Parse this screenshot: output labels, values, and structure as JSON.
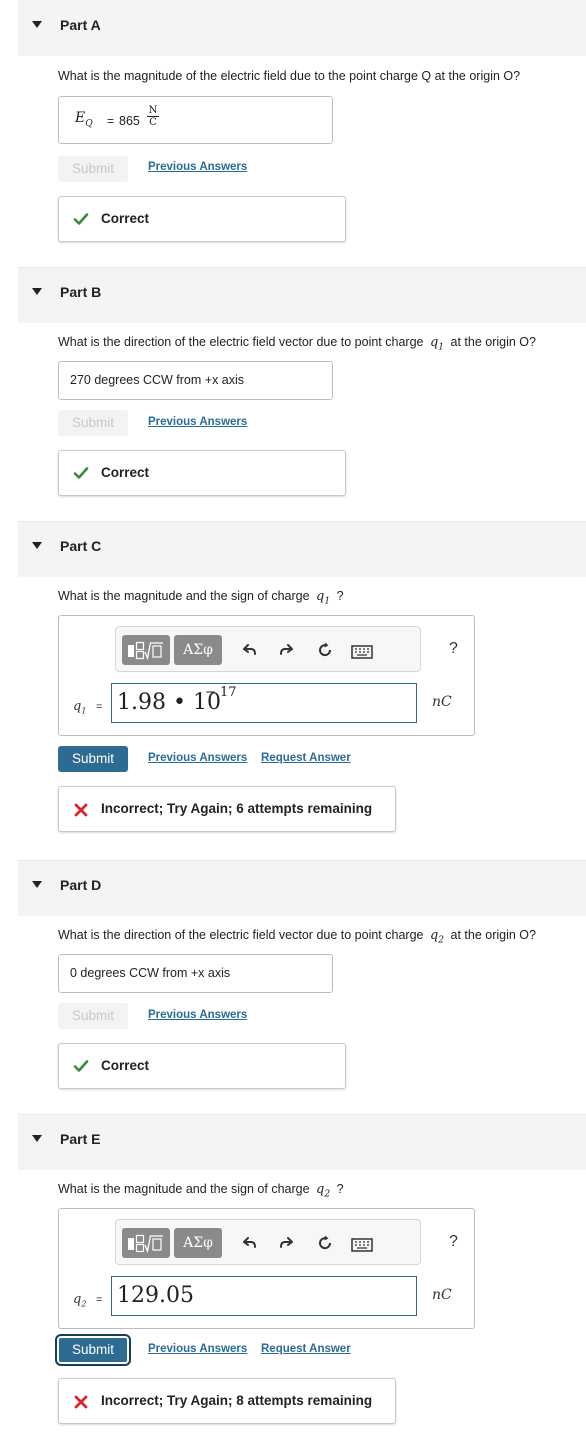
{
  "parts": {
    "a": {
      "title": "Part A",
      "question": "What is the magnitude of the electric field due to the point charge Q at the origin O?",
      "var_symbol": "E",
      "var_sub": "Q",
      "equals": "=",
      "value": "865",
      "unit_num": "N",
      "unit_den": "C",
      "submit": "Submit",
      "previous_answers": "Previous Answers",
      "feedback": "Correct"
    },
    "b": {
      "title": "Part B",
      "question_pre": "What is the direction of the electric field vector due to point charge",
      "var_symbol": "q",
      "var_sub": "1",
      "question_post": "at the origin O?",
      "answer": "270  degrees CCW from +x axis",
      "submit": "Submit",
      "previous_answers": "Previous Answers",
      "feedback": "Correct"
    },
    "c": {
      "title": "Part C",
      "question_pre": "What is the magnitude and the sign of charge",
      "var_symbol": "q",
      "var_sub": "1",
      "question_post": "?",
      "greek_button": "ΑΣφ",
      "help": "?",
      "var_label": "q",
      "var_label_sub": "1",
      "equals": "=",
      "input_value": "1.98 • 10",
      "input_exponent": "− 17",
      "unit": "nC",
      "submit": "Submit",
      "previous_answers": "Previous Answers",
      "request_answer": "Request Answer",
      "feedback": "Incorrect; Try Again; 6 attempts remaining"
    },
    "d": {
      "title": "Part D",
      "question_pre": "What is the direction of the electric field vector due to point charge",
      "var_symbol": "q",
      "var_sub": "2",
      "question_post": "at the origin O?",
      "answer": "0  degrees CCW from +x axis",
      "submit": "Submit",
      "previous_answers": "Previous Answers",
      "feedback": "Correct"
    },
    "e": {
      "title": "Part E",
      "question_pre": "What is the magnitude and the sign of charge",
      "var_symbol": "q",
      "var_sub": "2",
      "question_post": "?",
      "greek_button": "ΑΣφ",
      "help": "?",
      "var_label": "q",
      "var_label_sub": "2",
      "equals": "=",
      "input_value": "129.05",
      "unit": "nC",
      "submit": "Submit",
      "previous_answers": "Previous Answers",
      "request_answer": "Request Answer",
      "feedback": "Incorrect; Try Again; 8 attempts remaining"
    }
  },
  "colors": {
    "header_bg": "#f4f4f4",
    "primary_button": "#2d6b93",
    "link": "#2b6b9a",
    "correct": "#3a8a3a",
    "incorrect": "#d62a2a"
  }
}
